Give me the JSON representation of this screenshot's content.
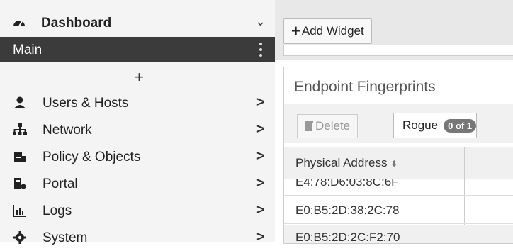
{
  "sidebar": {
    "dashboard_label": "Dashboard",
    "main_tab_label": "Main",
    "add_symbol": "+",
    "items": [
      {
        "label": "Users & Hosts",
        "icon": "user-icon"
      },
      {
        "label": "Network",
        "icon": "network-icon"
      },
      {
        "label": "Policy & Objects",
        "icon": "policy-icon"
      },
      {
        "label": "Portal",
        "icon": "portal-icon"
      },
      {
        "label": "Logs",
        "icon": "logs-icon"
      },
      {
        "label": "System",
        "icon": "gear-icon"
      }
    ],
    "arrow": ">",
    "chevron": "⌄"
  },
  "toolbar": {
    "add_widget_label": "Add Widget"
  },
  "widget": {
    "title": "Endpoint Fingerprints",
    "delete_label": "Delete",
    "filter_label": "Rogue",
    "filter_count": "0 of 1",
    "columns": [
      "Physical Address"
    ],
    "rows": [
      "E4:78:D6:03:8C:6F",
      "E0:B5:2D:38:2C:78",
      "E0:B5:2D:2C:F2:70"
    ]
  },
  "colors": {
    "sidebar_bg": "#f4f4f4",
    "active_tab_bg": "#3b3b3b",
    "badge_bg": "#777777"
  }
}
